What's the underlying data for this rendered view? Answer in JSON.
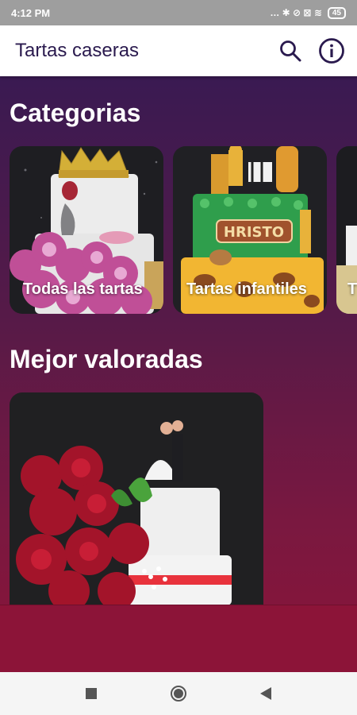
{
  "status_bar": {
    "time": "4:12 PM",
    "icons": "… ✱ ⊘ ⊠ ≋",
    "battery": "45"
  },
  "app_bar": {
    "title": "Tartas caseras",
    "search_icon": "search-icon",
    "info_icon": "info-icon"
  },
  "sections": {
    "categories_title": "Categorias",
    "best_rated_title": "Mejor valoradas"
  },
  "categories": [
    {
      "label": "Todas las tartas"
    },
    {
      "label": "Tartas infantiles"
    },
    {
      "label": "T"
    }
  ],
  "cake_text": "HRISTO",
  "colors": {
    "accent": "#2a1a4e",
    "gradient_top": "#3a1a52",
    "gradient_bottom": "#8a1438"
  },
  "nav": {
    "recents": "recents-icon",
    "home": "home-icon",
    "back": "back-icon"
  }
}
